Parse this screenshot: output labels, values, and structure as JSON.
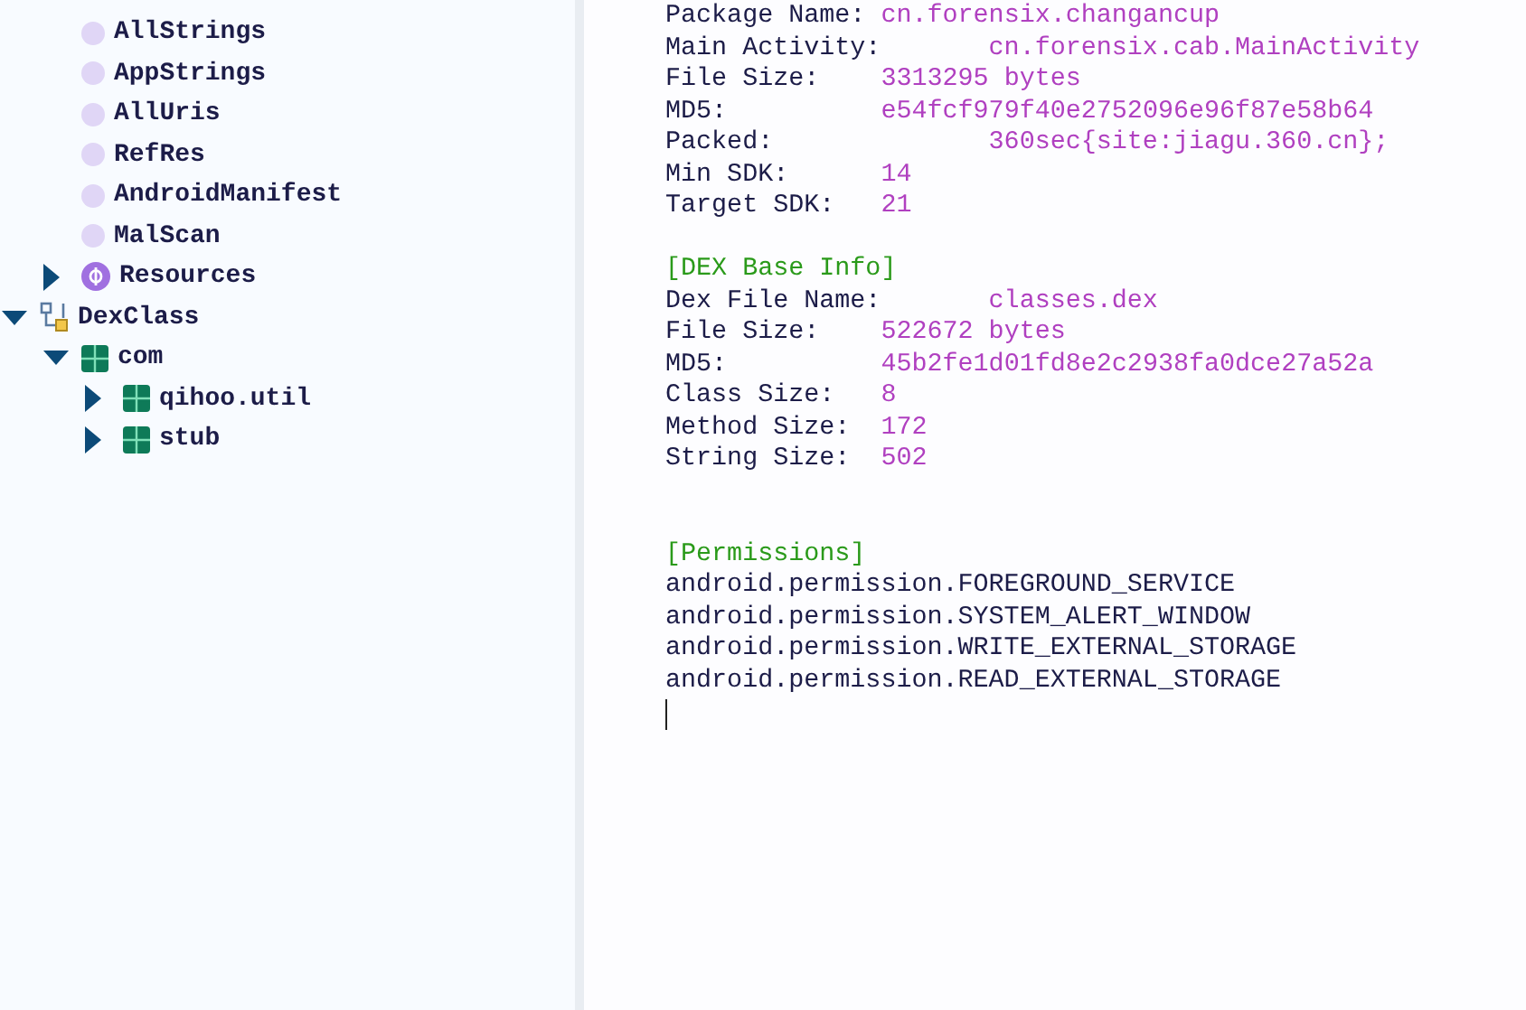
{
  "tree": {
    "scrolled_children": [
      {
        "label": "AllStrings",
        "kind": "leaf"
      },
      {
        "label": "AppStrings",
        "kind": "leaf"
      },
      {
        "label": "AllUris",
        "kind": "leaf"
      },
      {
        "label": "RefRes",
        "kind": "leaf"
      },
      {
        "label": "AndroidManifest",
        "kind": "leaf"
      },
      {
        "label": "MalScan",
        "kind": "leaf"
      },
      {
        "label": "Resources",
        "kind": "resources",
        "expanded": false
      }
    ],
    "nodes": [
      {
        "label": "DexClass",
        "kind": "dex",
        "expanded": true,
        "children": [
          {
            "label": "com",
            "kind": "package",
            "expanded": true,
            "children": [
              {
                "label": "qihoo.util",
                "kind": "package",
                "expanded": false
              },
              {
                "label": "stub",
                "kind": "package",
                "expanded": false
              }
            ]
          }
        ]
      }
    ]
  },
  "report": {
    "sections": [
      {
        "lines": [
          {
            "label": "Package Name:\t",
            "value": "cn.forensix.changancup"
          },
          {
            "label": "Main Activity:\t",
            "value": "cn.forensix.cab.MainActivity"
          },
          {
            "label": "File Size:\t",
            "value": "3313295 bytes"
          },
          {
            "label": "MD5:\t\t",
            "value": "e54fcf979f40e2752096e96f87e58b64"
          },
          {
            "label": "Packed:\t\t",
            "value": "360sec{site:jiagu.360.cn};"
          },
          {
            "label": "Min SDK:\t",
            "value": "14"
          },
          {
            "label": "Target SDK:\t",
            "value": "21"
          }
        ]
      },
      {
        "header": "[DEX Base Info]",
        "lines": [
          {
            "label": "Dex File Name:\t",
            "value": "classes.dex"
          },
          {
            "label": "File Size:\t",
            "value": "522672 bytes"
          },
          {
            "label": "MD5:\t\t",
            "value": "45b2fe1d01fd8e2c2938fa0dce27a52a"
          },
          {
            "label": "Class Size:\t",
            "value": "8"
          },
          {
            "label": "Method Size:\t",
            "value": "172"
          },
          {
            "label": "String Size:\t",
            "value": "502"
          }
        ]
      },
      {
        "header": "[Permissions]",
        "lines": [
          {
            "label": "android.permission.FOREGROUND_SERVICE"
          },
          {
            "label": "android.permission.SYSTEM_ALERT_WINDOW"
          },
          {
            "label": "android.permission.WRITE_EXTERNAL_STORAGE"
          },
          {
            "label": "android.permission.READ_EXTERNAL_STORAGE"
          }
        ]
      }
    ]
  }
}
